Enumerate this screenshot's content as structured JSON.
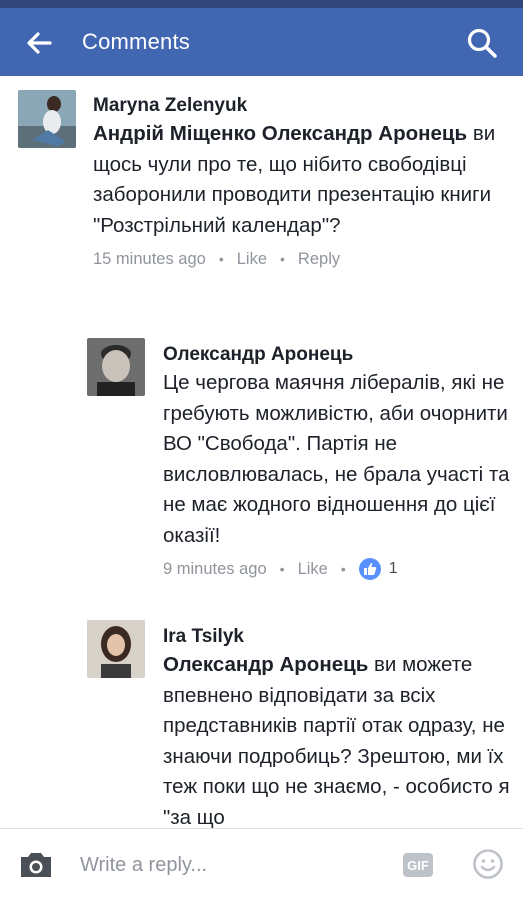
{
  "header": {
    "title": "Comments"
  },
  "comments": [
    {
      "author": "Maryna Zelenyuk",
      "mention": "Андрій Міщенко Олександр Аронець",
      "text": "ви щось чули про те, що нібито свободівці заборонили проводити презентацію книги \"Розстрільний календар\"?",
      "time": "15 minutes ago",
      "like": "Like",
      "reply": "Reply"
    },
    {
      "author": "Олександр Аронець",
      "text": "Це чергова маячня лібералів, які не гребують можливістю, аби очорнити ВО \"Свобода\". Партія не висловлювалась, не брала участі та не має жодного відношення до цієї оказії!",
      "time": "9 minutes ago",
      "like": "Like",
      "likes_count": "1"
    },
    {
      "author": "Ira Tsilyk",
      "mention": "Олександр Аронець",
      "text": "ви можете впевнено відповідати за всіх представників партії отак одразу, не знаючи подробиць? Зрештою, ми їх теж поки що не знаємо, - особисто я \"за що"
    }
  ],
  "composer": {
    "placeholder": "Write a reply...",
    "gif_label": "GIF"
  },
  "colors": {
    "header": "#4267b2",
    "statusbar": "#33467c",
    "meta": "#90949c",
    "like_badge": "#5890ff"
  }
}
